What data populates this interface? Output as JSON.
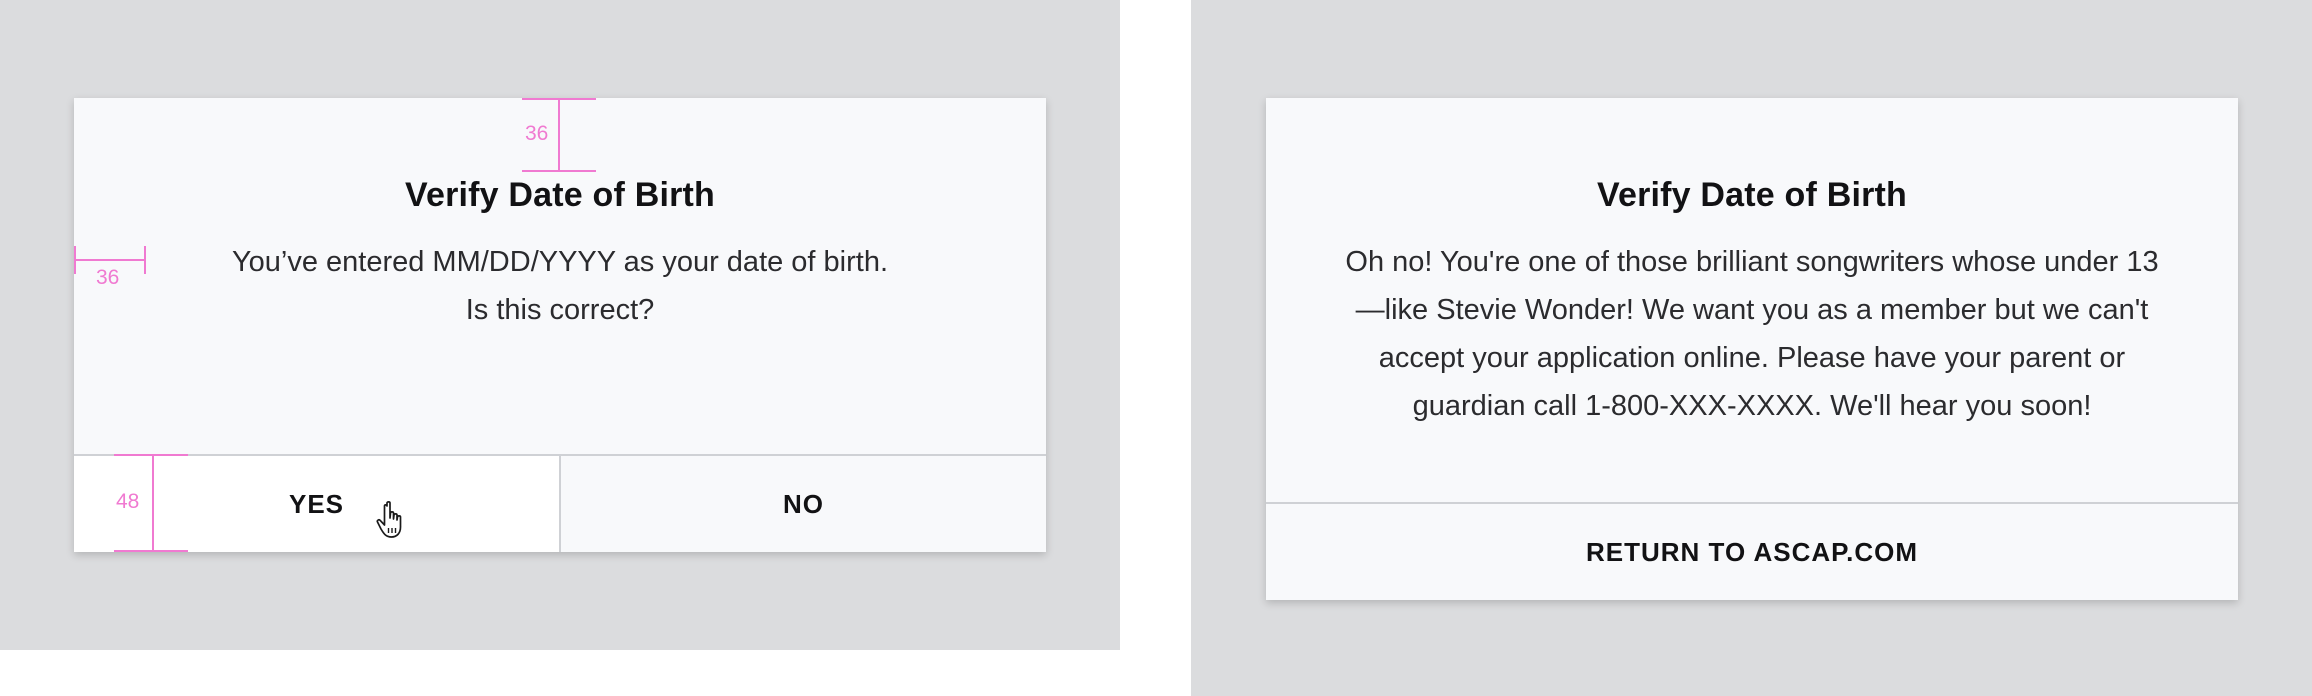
{
  "left_dialog": {
    "title": "Verify Date of Birth",
    "message_line1": "You’ve entered MM/DD/YYYY as your date of birth.",
    "message_line2": "Is this correct?",
    "yes_label": "YES",
    "no_label": "NO"
  },
  "right_dialog": {
    "title": "Verify Date of Birth",
    "message": "Oh no! You're one of those brilliant songwriters whose under 13—like Stevie Wonder! We want you as a member but we can't accept your application online. Please have your parent or guardian call 1-800-XXX-XXXX. We'll hear you soon!",
    "return_label": "RETURN TO ASCAP.COM"
  },
  "spec_annotations": {
    "top_padding": "36",
    "side_padding": "36",
    "button_height": "48",
    "color": "#f07ad1"
  },
  "colors": {
    "backdrop": "#dbdcde",
    "modal": "#f8f9fb",
    "button_hover": "#ffffff",
    "divider": "#cfd1d5"
  },
  "icons": {
    "cursor": "hand-pointer-icon"
  }
}
